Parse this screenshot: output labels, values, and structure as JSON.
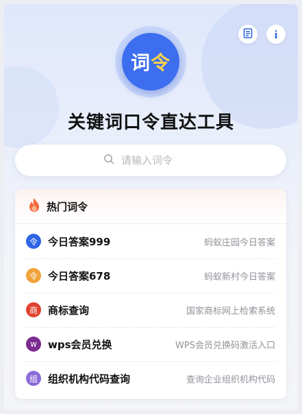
{
  "header": {
    "logo_text_main": "词",
    "logo_text_accent": "令",
    "title": "关键词口令直达工具"
  },
  "search": {
    "placeholder": "请输入词令",
    "value": ""
  },
  "hot": {
    "heading": "热门词令",
    "items": [
      {
        "badge": "令",
        "badge_color": "#2f63e6",
        "title": "今日答案999",
        "desc": "蚂蚁庄园今日答案"
      },
      {
        "badge": "令",
        "badge_color": "#f0a23b",
        "title": "今日答案678",
        "desc": "蚂蚁新村今日答案"
      },
      {
        "badge": "商",
        "badge_color": "#e0432f",
        "title": "商标查询",
        "desc": "国家商标网上检索系统"
      },
      {
        "badge": "w",
        "badge_color": "#7c2a8f",
        "title": "wps会员兑换",
        "desc": "WPS会员兑换码激活入口"
      },
      {
        "badge": "组",
        "badge_color": "#8a6bd8",
        "title": "组织机构代码查询",
        "desc": "查询企业组织机构代码"
      }
    ]
  },
  "icons": {
    "doc": "document-icon",
    "info": "info-icon",
    "search": "search-icon",
    "fire": "fire-icon"
  }
}
